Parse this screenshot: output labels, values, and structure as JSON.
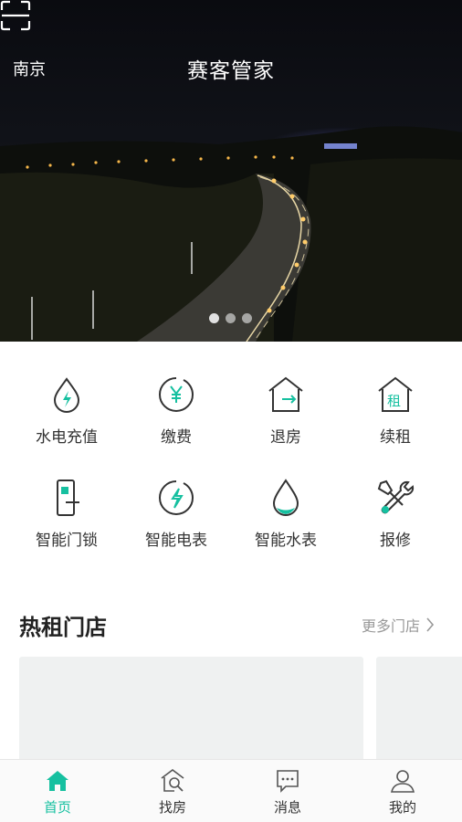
{
  "header": {
    "city": "南京",
    "title": "赛客管家"
  },
  "banner": {
    "slide_count": 3,
    "active_slide": 1
  },
  "services": [
    {
      "label": "水电充值",
      "icon": "water-drop-lightning-icon"
    },
    {
      "label": "缴费",
      "icon": "yen-payment-icon"
    },
    {
      "label": "退房",
      "icon": "house-checkout-icon"
    },
    {
      "label": "续租",
      "icon": "house-rent-icon"
    },
    {
      "label": "智能门锁",
      "icon": "smart-lock-icon"
    },
    {
      "label": "智能电表",
      "icon": "smart-meter-icon"
    },
    {
      "label": "智能水表",
      "icon": "water-meter-icon"
    },
    {
      "label": "报修",
      "icon": "repair-tools-icon"
    }
  ],
  "hot_stores": {
    "title": "热租门店",
    "more_label": "更多门店"
  },
  "tabbar": {
    "items": [
      {
        "label": "首页",
        "icon": "home-icon",
        "active": true
      },
      {
        "label": "找房",
        "icon": "house-search-icon",
        "active": false
      },
      {
        "label": "消息",
        "icon": "message-icon",
        "active": false
      },
      {
        "label": "我的",
        "icon": "user-icon",
        "active": false
      }
    ]
  },
  "colors": {
    "accent": "#16c0a0",
    "text": "#333333",
    "muted": "#999999",
    "card_bg": "#eff1f1"
  }
}
